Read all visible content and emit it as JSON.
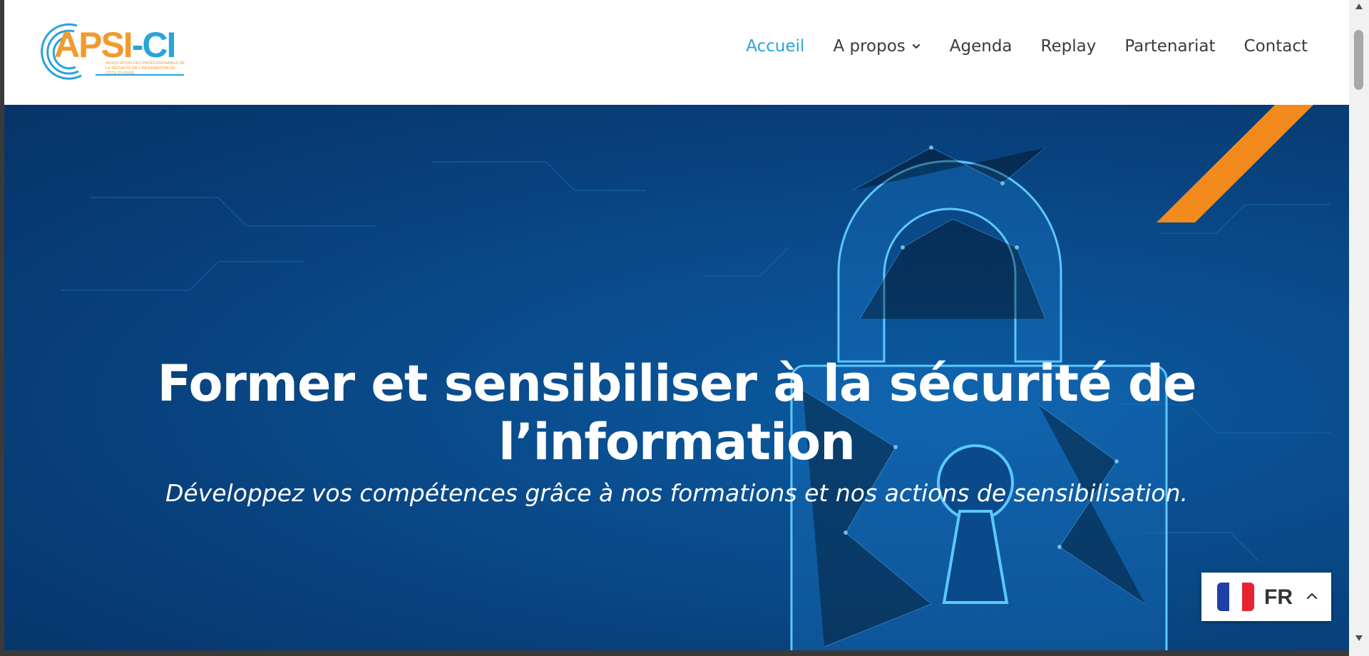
{
  "logo": {
    "wordmark_a": "APSI",
    "wordmark_b": "CI",
    "tagline": "Association des professionnels de la sécurité de l'information de Côte d'Ivoire"
  },
  "nav": {
    "items": [
      {
        "label": "Accueil",
        "active": true
      },
      {
        "label": "A propos",
        "has_dropdown": true
      },
      {
        "label": "Agenda"
      },
      {
        "label": "Replay"
      },
      {
        "label": "Partenariat"
      },
      {
        "label": "Contact"
      }
    ]
  },
  "hero": {
    "title_line1": "Former et sensibiliser à la sécurité de",
    "title_line2": "l’information",
    "subtitle": "Développez vos compétences grâce à nos formations et nos actions de sensibilisation.",
    "background_icon": "padlock-icon"
  },
  "language": {
    "code": "FR",
    "flag": "france-flag-icon"
  },
  "colors": {
    "accent": "#2aa2db",
    "logo_orange": "#f29a2e",
    "hero_blue": "#0a4a8a",
    "stripe_orange": "#f28a1e"
  }
}
